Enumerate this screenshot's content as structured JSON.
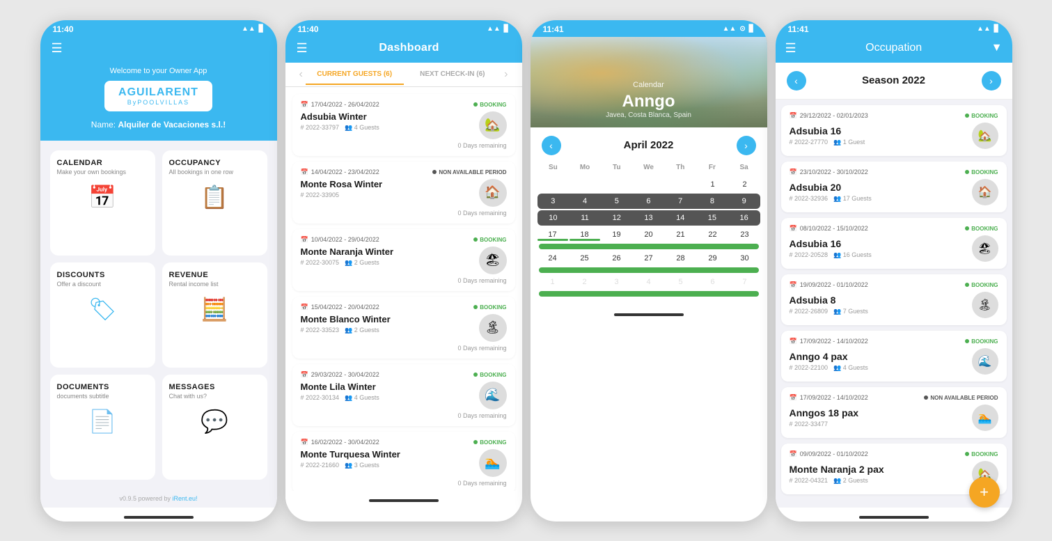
{
  "phone1": {
    "status_time": "11:40",
    "welcome": "Welcome to your Owner App",
    "logo_main": "AGUILARENT",
    "logo_sub": "ByPOOLVILLAS",
    "owner_label": "Name:",
    "owner_name": "Alquiler de Vacaciones s.l.!",
    "menu_items": [
      {
        "id": "calendar",
        "label": "CALENDAR",
        "sub": "Make your own bookings",
        "icon": "📅"
      },
      {
        "id": "occupancy",
        "label": "OCCUPANCY",
        "sub": "All bookings in one row",
        "icon": "📋"
      },
      {
        "id": "discounts",
        "label": "DISCOUNTS",
        "sub": "Offer a discount",
        "icon": "🏷"
      },
      {
        "id": "revenue",
        "label": "REVENUE",
        "sub": "Rental income list",
        "icon": "🧮"
      },
      {
        "id": "documents",
        "label": "DOCUMENTS",
        "sub": "documents subtitle",
        "icon": "📄"
      },
      {
        "id": "messages",
        "label": "MESSAGES",
        "sub": "Chat with us?",
        "icon": "💬"
      }
    ],
    "footer": "v0.9.5 powered by iRent.eu!"
  },
  "phone2": {
    "status_time": "11:40",
    "title": "Dashboard",
    "tab_prev": "‹",
    "tab_next": "›",
    "tabs": [
      {
        "label": "CURRENT GUESTS (6)",
        "active": true
      },
      {
        "label": "NEXT CHECK-IN (6)",
        "active": false
      }
    ],
    "bookings": [
      {
        "dates": "17/04/2022 - 26/04/2022",
        "status": "BOOKING",
        "status_type": "booking",
        "name": "Adsubia Winter",
        "ref": "# 2022-33797",
        "guests": "4 Guests",
        "remaining": "0 Days remaining",
        "thumb": "🏡"
      },
      {
        "dates": "14/04/2022 - 23/04/2022",
        "status": "NON AVAILABLE PERIOD",
        "status_type": "non-avail",
        "name": "Monte Rosa Winter",
        "ref": "# 2022-33905",
        "guests": "",
        "remaining": "0 Days remaining",
        "thumb": "🏠"
      },
      {
        "dates": "10/04/2022 - 29/04/2022",
        "status": "BOOKING",
        "status_type": "booking",
        "name": "Monte Naranja Winter",
        "ref": "# 2022-30075",
        "guests": "2 Guests",
        "remaining": "0 Days remaining",
        "thumb": "🏖"
      },
      {
        "dates": "15/04/2022 - 20/04/2022",
        "status": "BOOKING",
        "status_type": "booking",
        "name": "Monte Blanco Winter",
        "ref": "# 2022-33523",
        "guests": "2 Guests",
        "remaining": "0 Days remaining",
        "thumb": "🏝"
      },
      {
        "dates": "29/03/2022 - 30/04/2022",
        "status": "BOOKING",
        "status_type": "booking",
        "name": "Monte Lila Winter",
        "ref": "# 2022-30134",
        "guests": "4 Guests",
        "remaining": "0 Days remaining",
        "thumb": "🌊"
      },
      {
        "dates": "16/02/2022 - 30/04/2022",
        "status": "BOOKING",
        "status_type": "booking",
        "name": "Monte Turquesa Winter",
        "ref": "# 2022-21660",
        "guests": "3 Guests",
        "remaining": "0 Days remaining",
        "thumb": "🏊"
      }
    ]
  },
  "phone3": {
    "status_time": "11:41",
    "screen_label": "Calendar",
    "property_name": "Anngo",
    "location": "Javea, Costa Blanca, Spain",
    "nav_prev": "‹",
    "nav_next": "›",
    "month_title": "April 2022",
    "weekdays": [
      "Su",
      "Mo",
      "Tu",
      "We",
      "Th",
      "Fr",
      "Sa"
    ],
    "days_row1": [
      "",
      "",
      "",
      "",
      "",
      "1",
      "2"
    ],
    "days_row2": [
      "3",
      "4",
      "5",
      "6",
      "7",
      "8",
      "9"
    ],
    "days_row3": [
      "10",
      "11",
      "12",
      "13",
      "14",
      "15",
      "16"
    ],
    "days_row4": [
      "17",
      "18",
      "19",
      "20",
      "21",
      "22",
      "23"
    ],
    "days_row5": [
      "24",
      "25",
      "26",
      "27",
      "28",
      "29",
      "30"
    ],
    "days_row6": [
      "1",
      "2",
      "3",
      "4",
      "5",
      "6",
      "7"
    ]
  },
  "phone4": {
    "status_time": "11:41",
    "title": "Occupation",
    "filter_icon": "▼",
    "season_prev": "‹",
    "season_next": "›",
    "season_title": "Season 2022",
    "bookings": [
      {
        "dates": "29/12/2022 - 02/01/2023",
        "status": "BOOKING",
        "status_type": "booking",
        "name": "Adsubia 16",
        "ref": "# 2022-27770",
        "guests": "1 Guest",
        "thumb": "🏡"
      },
      {
        "dates": "23/10/2022 - 30/10/2022",
        "status": "BOOKING",
        "status_type": "booking",
        "name": "Adsubia 20",
        "ref": "# 2022-32936",
        "guests": "17 Guests",
        "thumb": "🏠"
      },
      {
        "dates": "08/10/2022 - 15/10/2022",
        "status": "BOOKING",
        "status_type": "booking",
        "name": "Adsubia 16",
        "ref": "# 2022-20528",
        "guests": "16 Guests",
        "thumb": "🏖"
      },
      {
        "dates": "19/09/2022 - 01/10/2022",
        "status": "BOOKING",
        "status_type": "booking",
        "name": "Adsubia 8",
        "ref": "# 2022-26809",
        "guests": "7 Guests",
        "thumb": "🏝"
      },
      {
        "dates": "17/09/2022 - 14/10/2022",
        "status": "BOOKING",
        "status_type": "booking",
        "name": "Anngo 4 pax",
        "ref": "# 2022-22100",
        "guests": "4 Guests",
        "thumb": "🌊"
      },
      {
        "dates": "17/09/2022 - 14/10/2022",
        "status": "NON AVAILABLE PERIOD",
        "status_type": "non-avail",
        "name": "Anngos 18 pax",
        "ref": "# 2022-33477",
        "guests": "",
        "thumb": "🏊"
      },
      {
        "dates": "09/09/2022 - 01/10/2022",
        "status": "BOOKING",
        "status_type": "booking",
        "name": "Monte Naranja 2 pax",
        "ref": "# 2022-04321",
        "guests": "2 Guests",
        "thumb": "🏡"
      }
    ],
    "fab_icon": "+"
  }
}
